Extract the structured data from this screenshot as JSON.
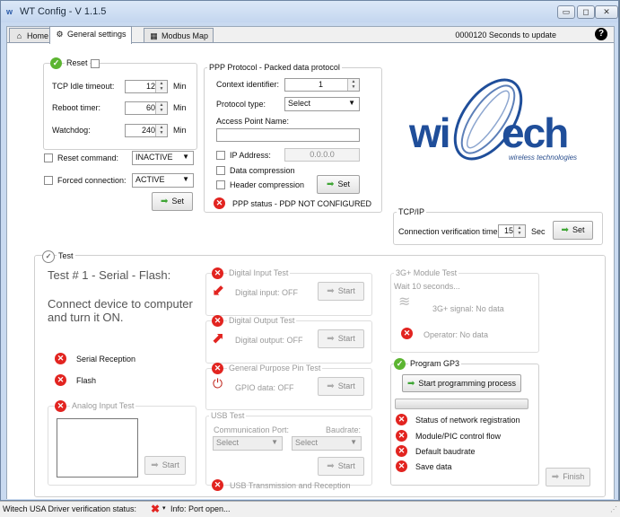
{
  "window": {
    "title": "WT Config - V 1.1.5",
    "min": "▭",
    "max": "◻",
    "close": "✕"
  },
  "tabs": [
    {
      "label": "Home",
      "icon": "home-icon",
      "glyph": "⌂"
    },
    {
      "label": "General settings",
      "icon": "gear-icon",
      "glyph": "⚙"
    },
    {
      "label": "Modbus Map",
      "icon": "table-icon",
      "glyph": "▦"
    }
  ],
  "update_status": "0000120 Seconds to update",
  "help": "?",
  "reset": {
    "title": "Reset",
    "tcp_label": "TCP Idle timeout:",
    "tcp_value": "12",
    "reboot_label": "Reboot timer:",
    "reboot_value": "60",
    "watchdog_label": "Watchdog:",
    "watchdog_value": "240",
    "unit": "Min",
    "reset_command_label": "Reset command:",
    "reset_command_value": "INACTIVE",
    "forced_label": "Forced connection:",
    "forced_value": "ACTIVE",
    "set": "Set"
  },
  "ppp": {
    "title": "PPP Protocol - Packed data protocol",
    "context_label": "Context identifier:",
    "context_value": "1",
    "protocol_label": "Protocol type:",
    "protocol_value": "Select",
    "apn_label": "Access Point Name:",
    "apn_value": "",
    "ip_label": "IP Address:",
    "ip_value": "0.0.0.0",
    "data_comp": "Data compression",
    "header_comp": "Header compression",
    "set": "Set",
    "status": "PPP status - PDP NOT CONFIGURED"
  },
  "logo": {
    "text_wi": "wi",
    "text_ech": "ech",
    "tagline": "wireless technologies"
  },
  "tcpip": {
    "title": "TCP/IP",
    "label": "Connection verification time:",
    "value": "15",
    "unit": "Sec",
    "set": "Set"
  },
  "test": {
    "title": "Test",
    "heading": "Test # 1 - Serial - Flash:",
    "instruction": "Connect device to computer and turn it ON.",
    "serial": "Serial Reception",
    "flash": "Flash",
    "analog": {
      "title": "Analog Input Test",
      "start": "Start"
    },
    "digital_in": {
      "title": "Digital Input Test",
      "status": "Digital input: OFF",
      "start": "Start"
    },
    "digital_out": {
      "title": "Digital Output Test",
      "status": "Digital output: OFF",
      "start": "Start"
    },
    "gpio": {
      "title": "General Purpose Pin Test",
      "status": "GPIO data: OFF",
      "start": "Start"
    },
    "usb": {
      "title": "USB Test",
      "port_label": "Communication Port:",
      "baud_label": "Baudrate:",
      "port_value": "Select",
      "baud_value": "Select",
      "start": "Start",
      "status": "USB Transmission and Reception"
    },
    "module": {
      "title": "3G+ Module Test",
      "wait": "Wait 10 seconds...",
      "signal": "3G+ signal: No data",
      "operator": "Operator: No data"
    },
    "program": {
      "title": "Program GP3",
      "button": "Start programming process",
      "progress": 0,
      "items": [
        "Status of network registration",
        "Module/PIC control flow",
        "Default baudrate",
        "Save data"
      ]
    },
    "finish": "Finish"
  },
  "statusbar": {
    "label": "Witech USA Driver verification status:",
    "info": "Info: Port open..."
  },
  "colors": {
    "accent_green": "#3fa535",
    "error_red": "#e22420",
    "logo_blue": "#1f4e9a"
  }
}
